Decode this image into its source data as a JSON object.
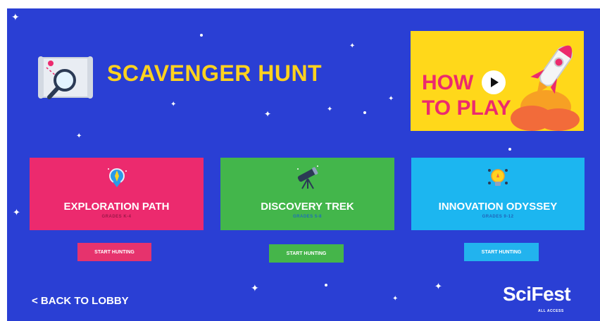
{
  "header": {
    "title": "SCAVENGER HUNT"
  },
  "how_to_play": {
    "line1": "HOW",
    "line2": "TO PLAY"
  },
  "cards": [
    {
      "title": "EXPLORATION PATH",
      "grades": "GRADES K-4",
      "button": "START HUNTING",
      "color": "#ec2a6e",
      "button_color": "#e6336d",
      "grade_color": "#9a1848",
      "icon": "compass-pin-icon"
    },
    {
      "title": "DISCOVERY TREK",
      "grades": "GRADES 5-8",
      "button": "START HUNTING",
      "color": "#43b64b",
      "button_color": "#45b54a",
      "grade_color": "#1f6fb8",
      "icon": "telescope-icon"
    },
    {
      "title": "INNOVATION ODYSSEY",
      "grades": "GRADES 9-12",
      "button": "START HUNTING",
      "color": "#1cb6f0",
      "button_color": "#22b3ee",
      "grade_color": "#1f63b8",
      "icon": "lightbulb-icon"
    }
  ],
  "footer": {
    "back_label": "< BACK TO LOBBY",
    "logo": "SciFest",
    "logo_sub": "ALL ACCESS"
  },
  "colors": {
    "background": "#2a3fd4",
    "title": "#ffd21f",
    "how_to_bg": "#ffd81a",
    "how_to_text": "#ec2a6e"
  }
}
